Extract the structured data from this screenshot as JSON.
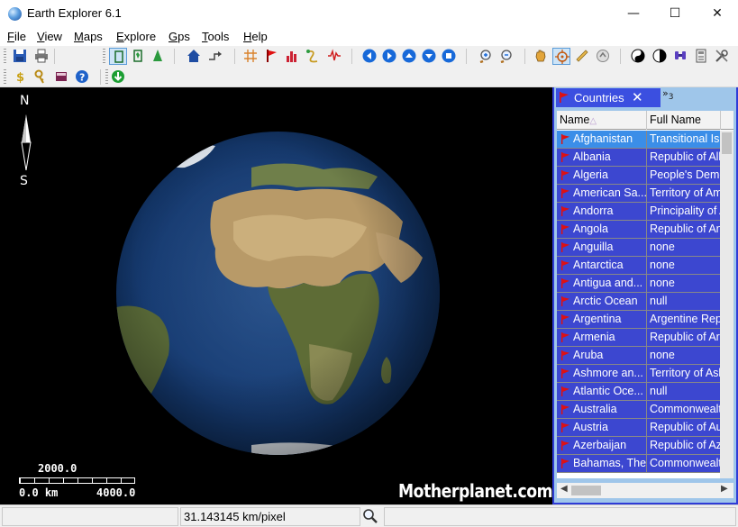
{
  "window": {
    "title": "Earth Explorer 6.1",
    "controls": {
      "minimize": "—",
      "maximize": "☐",
      "close": "✕"
    }
  },
  "menu": [
    {
      "key": "F",
      "rest": "ile"
    },
    {
      "key": "V",
      "rest": "iew"
    },
    {
      "key": "M",
      "rest": "aps"
    },
    {
      "key": "E",
      "rest": "xplore"
    },
    {
      "key": "G",
      "rest": "ps"
    },
    {
      "key": "T",
      "rest": "ools"
    },
    {
      "key": "H",
      "rest": "elp"
    }
  ],
  "toolbar": {
    "buttons": [
      "save-icon",
      "print-icon",
      "globe-view-icon",
      "flat-map-icon",
      "terrain-icon",
      "home-icon",
      "goto-icon",
      "grid-icon",
      "flag-icon",
      "chart-icon",
      "route-icon",
      "signal-icon",
      "back-icon",
      "forward-icon",
      "up-icon",
      "down-icon",
      "stop-icon",
      "zoom-in-icon",
      "zoom-out-icon",
      "pan-icon",
      "center-icon",
      "ruler-icon",
      "measure-icon",
      "yin-yang-icon",
      "contrast-icon",
      "search-people-icon",
      "calculator-icon",
      "tools-icon"
    ],
    "row2": [
      "currency-icon",
      "keys-icon",
      "book-icon",
      "help-icon",
      "download-icon"
    ],
    "pressed": "globe-view-icon"
  },
  "map": {
    "compass": {
      "north": "N",
      "south": "S"
    },
    "scale": {
      "mid": "2000.0",
      "start": "0.0 km",
      "end": "4000.0"
    },
    "watermark": "Motherplanet.com"
  },
  "panel": {
    "tab_title": "Countries",
    "tab_close": "✕",
    "overflow_label": "»",
    "overflow_count": "3",
    "columns": {
      "name": "Name",
      "sort_indicator": "△",
      "full": "Full Name"
    },
    "rows": [
      {
        "name": "Afghanistan",
        "full": "Transitional Islamic State of Afghanistan"
      },
      {
        "name": "Albania",
        "full": "Republic of Albania"
      },
      {
        "name": "Algeria",
        "full": "People's Democratic Republic of Algeria"
      },
      {
        "name": "American Sa...",
        "full": "Territory of American Samoa"
      },
      {
        "name": "Andorra",
        "full": "Principality of Andorra"
      },
      {
        "name": "Angola",
        "full": "Republic of Angola"
      },
      {
        "name": "Anguilla",
        "full": "none"
      },
      {
        "name": "Antarctica",
        "full": "none"
      },
      {
        "name": "Antigua and...",
        "full": "none"
      },
      {
        "name": "Arctic Ocean",
        "full": "null"
      },
      {
        "name": "Argentina",
        "full": "Argentine Republic"
      },
      {
        "name": "Armenia",
        "full": "Republic of Armenia"
      },
      {
        "name": "Aruba",
        "full": "none"
      },
      {
        "name": "Ashmore an...",
        "full": "Territory of Ashmore"
      },
      {
        "name": "Atlantic Oce...",
        "full": "null"
      },
      {
        "name": "Australia",
        "full": "Commonwealth of Australia"
      },
      {
        "name": "Austria",
        "full": "Republic of Austria"
      },
      {
        "name": "Azerbaijan",
        "full": "Republic of Azerbaijan"
      },
      {
        "name": "Bahamas, The",
        "full": "Commonwealth of The Bahamas"
      }
    ],
    "selected_index": 0,
    "hscroll": {
      "left": "◀",
      "right": "▶"
    }
  },
  "status": {
    "scale_text": "31.143145 km/pixel"
  },
  "colors": {
    "panel_bg": "#9fc6ea",
    "row_bg": "#3c47d0",
    "row_selected": "#3b8ee8",
    "flag_red": "#e01010"
  }
}
